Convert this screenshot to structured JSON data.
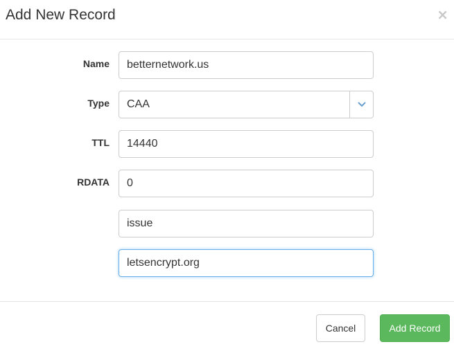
{
  "dialog": {
    "title": "Add New Record",
    "close_glyph": "×"
  },
  "form": {
    "name_label": "Name",
    "name_value": "betternetwork.us",
    "type_label": "Type",
    "type_value": "CAA",
    "ttl_label": "TTL",
    "ttl_value": "14440",
    "rdata_label": "RDATA",
    "rdata_values": [
      "0",
      "issue",
      "letsencrypt.org"
    ]
  },
  "footer": {
    "cancel_label": "Cancel",
    "add_label": "Add Record"
  },
  "colors": {
    "primary_success": "#5cb85c",
    "focus_border": "#66afe9",
    "select_arrow": "#6a9fd0"
  },
  "icons": {
    "close": "close-icon",
    "select_arrow": "chevron-down-icon"
  }
}
